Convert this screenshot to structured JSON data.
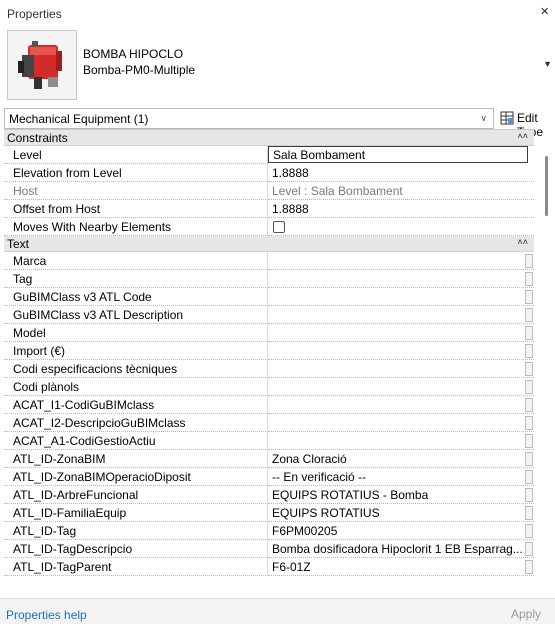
{
  "window": {
    "title": "Properties",
    "close_glyph": "×"
  },
  "type_selector": {
    "family": "BOMBA HIPOCLO",
    "type": "Bomba-PM0-Multiple",
    "thumbnail_icon": "pump-icon"
  },
  "filter": {
    "value": "Mechanical Equipment (1)",
    "edit_type_label": "Edit Type",
    "edit_type_icon": "edit-type-icon"
  },
  "groups": {
    "constraints": {
      "label": "Constraints",
      "rows": [
        {
          "name": "Level",
          "value": "Sala Bombament"
        },
        {
          "name": "Elevation from Level",
          "value": "1.8888"
        },
        {
          "name": "Host",
          "value": "Level : Sala Bombament"
        },
        {
          "name": "Offset from Host",
          "value": "1.8888"
        },
        {
          "name": "Moves With Nearby Elements",
          "value": ""
        }
      ]
    },
    "text": {
      "label": "Text",
      "rows": [
        {
          "name": "Marca",
          "value": ""
        },
        {
          "name": "Tag",
          "value": ""
        },
        {
          "name": "GuBIMClass v3 ATL Code",
          "value": ""
        },
        {
          "name": "GuBIMClass v3 ATL Description",
          "value": ""
        },
        {
          "name": "Model",
          "value": ""
        },
        {
          "name": "Import (€)",
          "value": ""
        },
        {
          "name": "Codi especificacions tècniques",
          "value": ""
        },
        {
          "name": "Codi plànols",
          "value": ""
        },
        {
          "name": "ACAT_I1-CodiGuBIMclass",
          "value": ""
        },
        {
          "name": "ACAT_I2-DescripcioGuBIMclass",
          "value": ""
        },
        {
          "name": "ACAT_A1-CodiGestioActiu",
          "value": ""
        },
        {
          "name": "ATL_ID-ZonaBIM",
          "value": "Zona Cloració"
        },
        {
          "name": "ATL_ID-ZonaBIMOperacioDiposit",
          "value": "-- En verificació --"
        },
        {
          "name": "ATL_ID-ArbreFuncional",
          "value": "EQUIPS ROTATIUS - Bomba"
        },
        {
          "name": "ATL_ID-FamiliaEquip",
          "value": "EQUIPS ROTATIUS"
        },
        {
          "name": "ATL_ID-Tag",
          "value": "F6PM00205"
        },
        {
          "name": "ATL_ID-TagDescripcio",
          "value": "Bomba dosificadora Hipoclorit 1 EB Esparrag..."
        },
        {
          "name": "ATL_ID-TagParent",
          "value": "F6-01Z"
        }
      ]
    }
  },
  "footer": {
    "help_link": "Properties help",
    "apply_label": "Apply"
  }
}
